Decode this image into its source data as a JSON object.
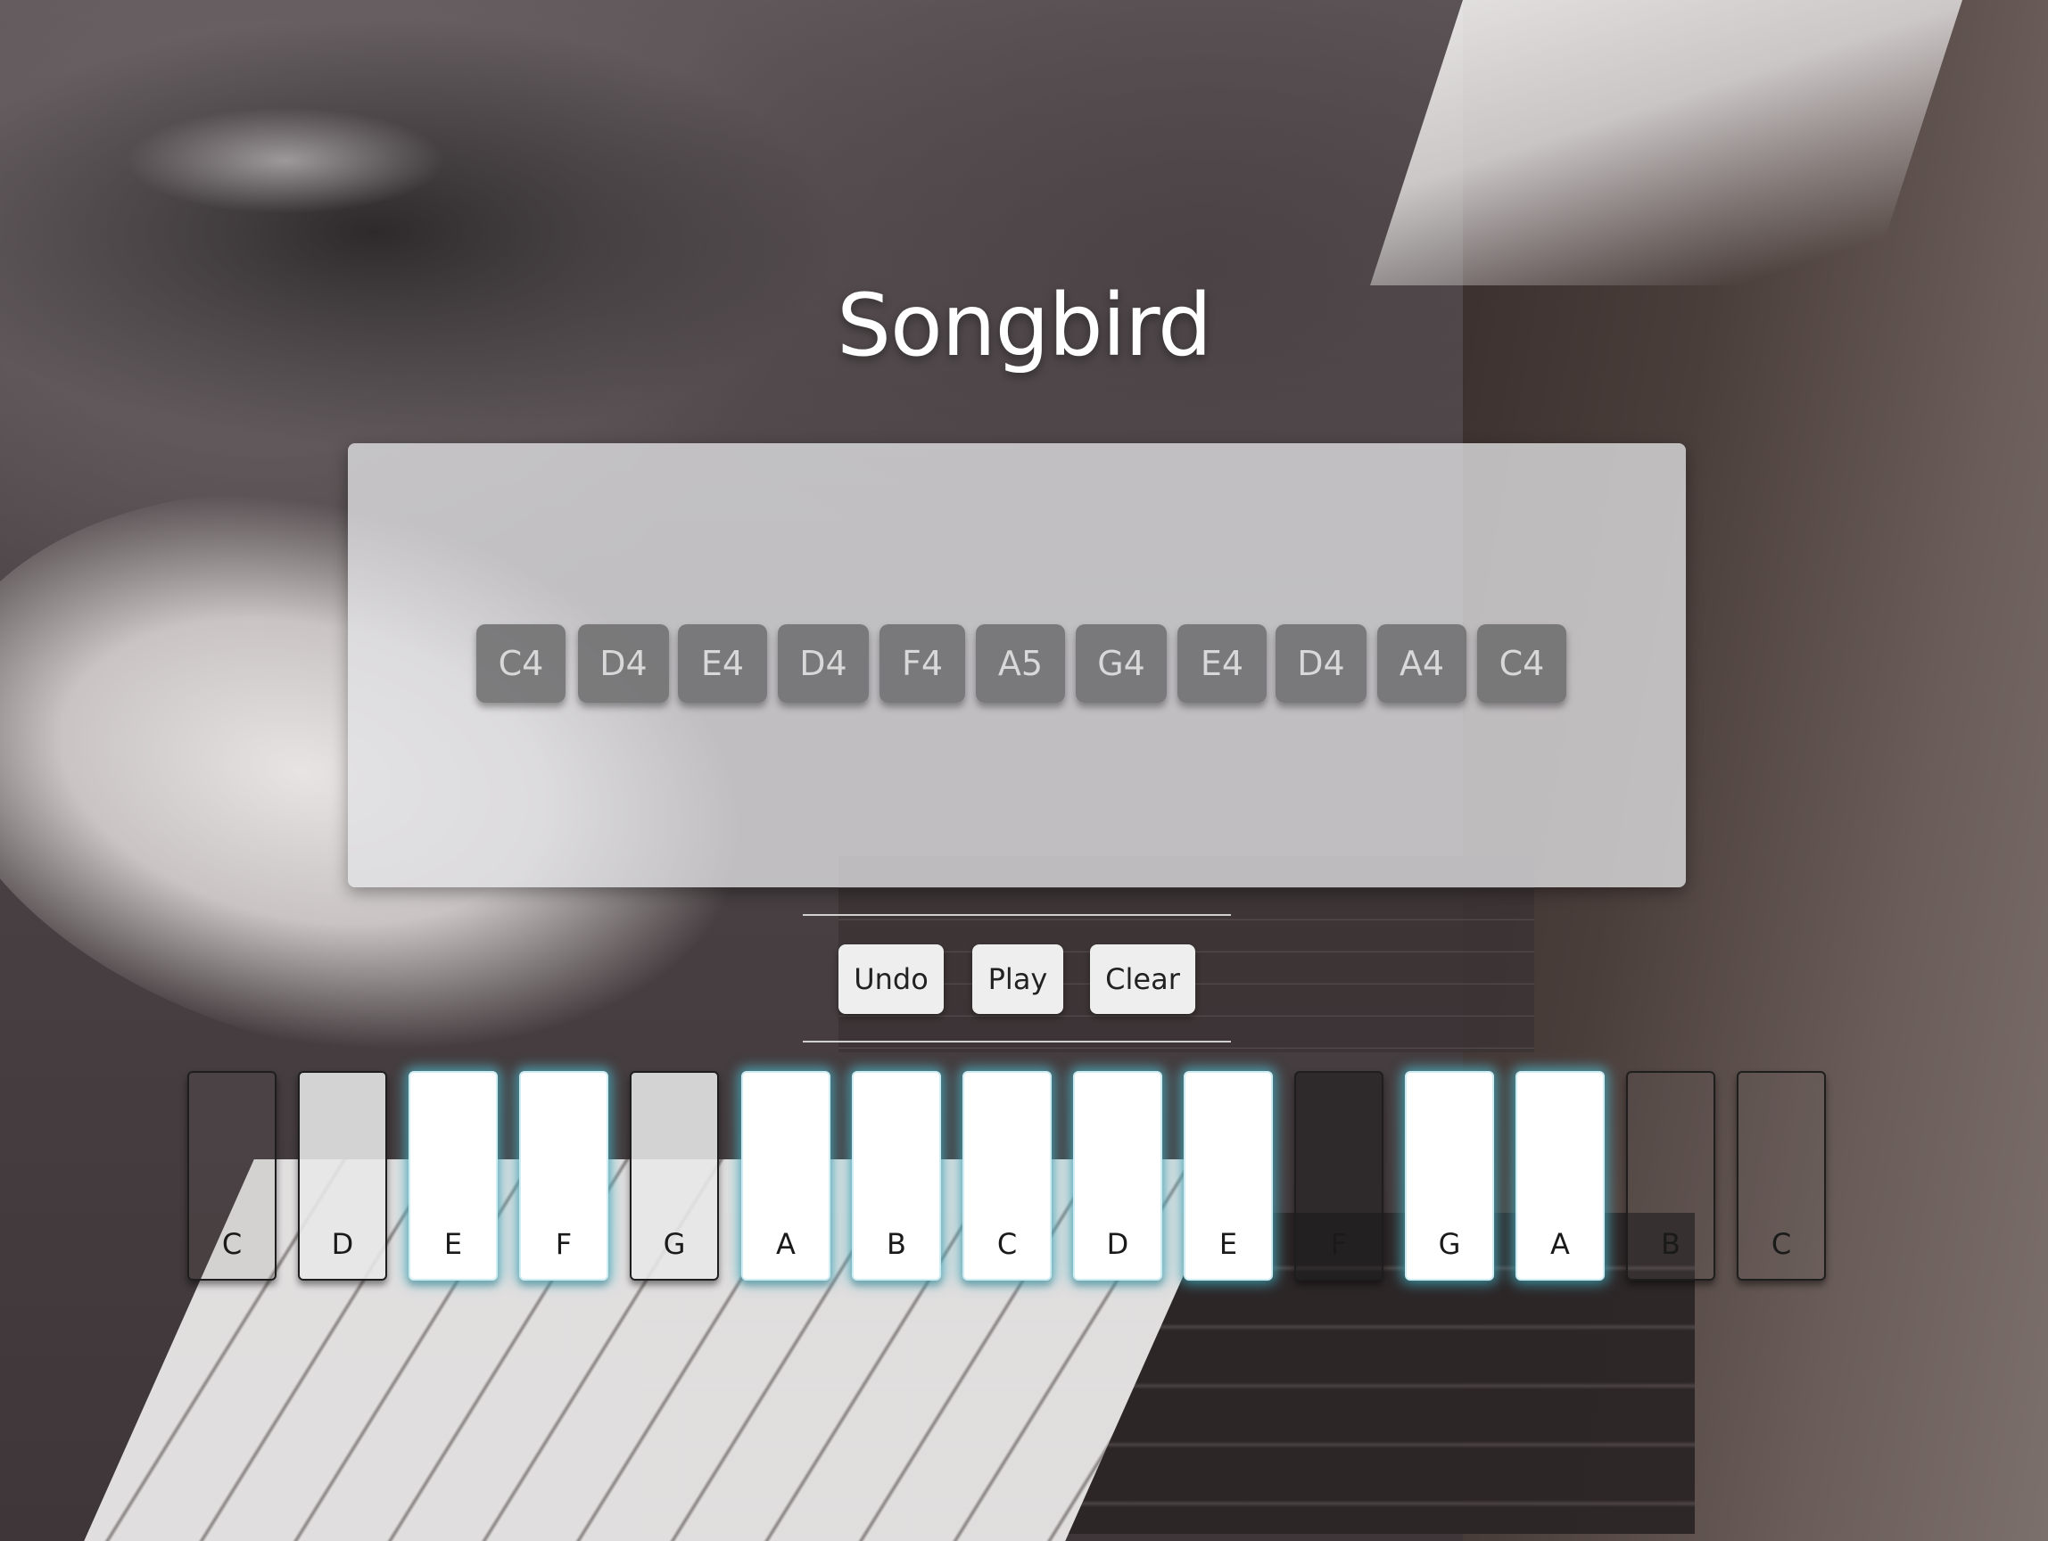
{
  "app": {
    "title": "Songbird"
  },
  "sequence": {
    "notes": [
      "C4",
      "D4",
      "E4",
      "D4",
      "F4",
      "A5",
      "G4",
      "E4",
      "D4",
      "A4",
      "C4"
    ]
  },
  "controls": {
    "undo_label": "Undo",
    "play_label": "Play",
    "clear_label": "Clear"
  },
  "keyboard": {
    "keys": [
      {
        "label": "C",
        "state": "clear"
      },
      {
        "label": "D",
        "state": "light"
      },
      {
        "label": "E",
        "state": "lit"
      },
      {
        "label": "F",
        "state": "lit"
      },
      {
        "label": "G",
        "state": "light"
      },
      {
        "label": "A",
        "state": "lit"
      },
      {
        "label": "B",
        "state": "lit"
      },
      {
        "label": "C",
        "state": "lit"
      },
      {
        "label": "D",
        "state": "lit"
      },
      {
        "label": "E",
        "state": "lit"
      },
      {
        "label": "F",
        "state": "dark"
      },
      {
        "label": "G",
        "state": "lit"
      },
      {
        "label": "A",
        "state": "lit"
      },
      {
        "label": "B",
        "state": "clear"
      },
      {
        "label": "C",
        "state": "clear"
      }
    ],
    "highlight_color": "#50bed2"
  }
}
